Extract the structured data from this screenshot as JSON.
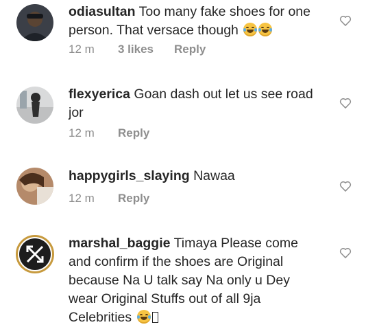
{
  "comments": [
    {
      "username": "odiasultan",
      "text": "Too many fake shoes for one person. That versace though",
      "time": "12 m",
      "likes": "3 likes",
      "reply": "Reply",
      "emoji": [
        "face-with-tears-of-joy-icon",
        "face-with-tears-of-joy-icon"
      ]
    },
    {
      "username": "flexyerica",
      "text": "Goan dash out let us see road jor",
      "time": "12 m",
      "reply": "Reply"
    },
    {
      "username": "happygirls_slaying",
      "text": "Nawaa",
      "time": "12 m",
      "reply": "Reply"
    },
    {
      "username": "marshal_baggie",
      "text": "Timaya Please come and confirm if the shoes are Original because Na U talk say Na only u Dey wear Original Stuffs out of all 9ja Celebrities",
      "emoji": [
        "face-with-tears-of-joy-icon",
        "missing-glyph-icon"
      ]
    }
  ],
  "colors": {
    "text": "#262626",
    "meta": "#8e8e8e",
    "story_ring": "#c79a3e"
  }
}
